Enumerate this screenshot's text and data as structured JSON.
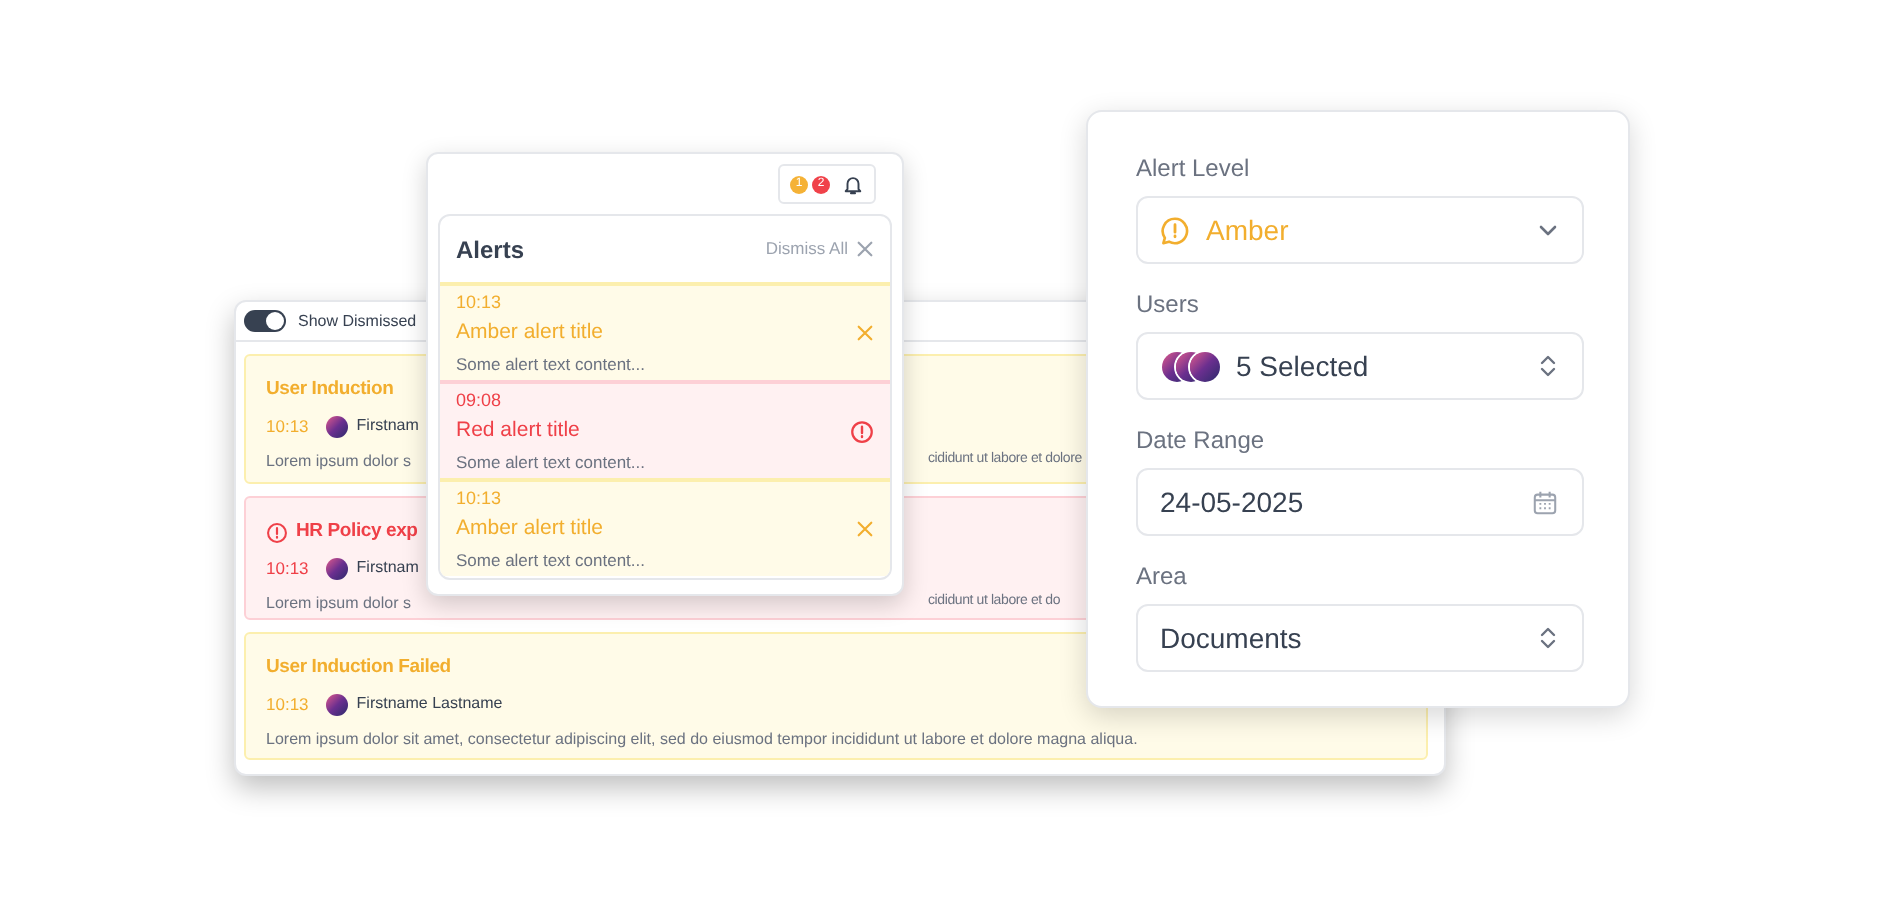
{
  "toggle": {
    "label": "Show Dismissed",
    "on": true
  },
  "cards": [
    {
      "kind": "amber",
      "title": "User Induction",
      "time": "10:13",
      "author": "Firstnam",
      "text": [
        "Lorem ipsum dolor s",
        "cididunt ut labore et dolore"
      ]
    },
    {
      "kind": "red",
      "title": "HR Policy exp",
      "time": "10:13",
      "author": "Firstnam",
      "text": [
        "Lorem ipsum dolor s",
        "cididunt ut labore et do"
      ]
    },
    {
      "kind": "amber",
      "title": "User Induction Failed",
      "time": "10:13",
      "author": "Firstname Lastname",
      "text": [
        "Lorem ipsum dolor sit amet, consectetur adipiscing elit, sed do eiusmod tempor incididunt ut labore et dolore magna aliqua."
      ]
    }
  ],
  "alerts_popup": {
    "badges": [
      {
        "count": "1",
        "color": "#f5b236"
      },
      {
        "count": "2",
        "color": "#f0424a"
      }
    ],
    "title": "Alerts",
    "dismiss_all": "Dismiss All",
    "alerts": [
      {
        "kind": "amber",
        "time": "10:13",
        "title": "Amber alert title",
        "text": "Some alert text content..."
      },
      {
        "kind": "red",
        "time": "09:08",
        "title": "Red alert title",
        "text": "Some alert text content..."
      },
      {
        "kind": "amber",
        "time": "10:13",
        "title": "Amber alert title",
        "text": "Some alert text content..."
      }
    ]
  },
  "settings": {
    "fields": [
      {
        "kind": "level-select",
        "label": "Alert Level",
        "value": "Amber",
        "color": "#f2ae2e"
      },
      {
        "kind": "users",
        "label": "Users",
        "value": "5 Selected"
      },
      {
        "kind": "date",
        "label": "Date Range",
        "value": "24-05-2025"
      },
      {
        "kind": "select",
        "label": "Area",
        "value": "Documents"
      }
    ]
  }
}
